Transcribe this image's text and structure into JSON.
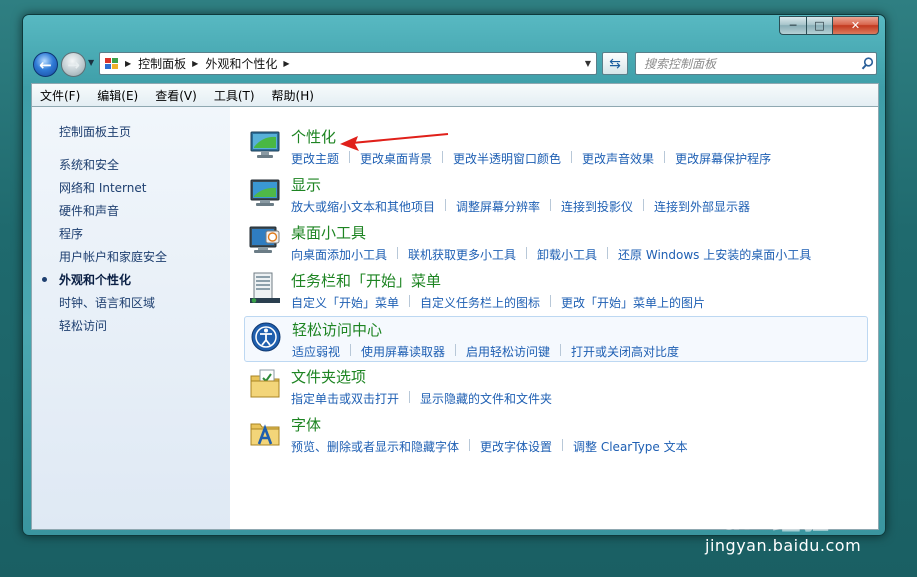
{
  "window": {
    "caption_min": "─",
    "caption_max": "□",
    "caption_close": "✕"
  },
  "address_bar": {
    "crumbs": [
      "控制面板",
      "外观和个性化"
    ],
    "search_placeholder": "搜索控制面板"
  },
  "menu": [
    "文件(F)",
    "编辑(E)",
    "查看(V)",
    "工具(T)",
    "帮助(H)"
  ],
  "sidebar": {
    "home": "控制面板主页",
    "items": [
      "系统和安全",
      "网络和 Internet",
      "硬件和声音",
      "程序",
      "用户帐户和家庭安全",
      "外观和个性化",
      "时钟、语言和区域",
      "轻松访问"
    ],
    "active_index": 5
  },
  "categories": [
    {
      "title": "个性化",
      "icon": "personalization-icon",
      "links": [
        "更改主题",
        "更改桌面背景",
        "更改半透明窗口颜色",
        "更改声音效果",
        "更改屏幕保护程序"
      ]
    },
    {
      "title": "显示",
      "icon": "display-icon",
      "links": [
        "放大或缩小文本和其他项目",
        "调整屏幕分辨率",
        "连接到投影仪",
        "连接到外部显示器"
      ]
    },
    {
      "title": "桌面小工具",
      "icon": "gadgets-icon",
      "links": [
        "向桌面添加小工具",
        "联机获取更多小工具",
        "卸载小工具",
        "还原 Windows 上安装的桌面小工具"
      ]
    },
    {
      "title": "任务栏和「开始」菜单",
      "icon": "taskbar-icon",
      "links": [
        "自定义「开始」菜单",
        "自定义任务栏上的图标",
        "更改「开始」菜单上的图片"
      ]
    },
    {
      "title": "轻松访问中心",
      "icon": "ease-of-access-icon",
      "links": [
        "适应弱视",
        "使用屏幕读取器",
        "启用轻松访问键",
        "打开或关闭高对比度"
      ]
    },
    {
      "title": "文件夹选项",
      "icon": "folder-options-icon",
      "links": [
        "指定单击或双击打开",
        "显示隐藏的文件和文件夹"
      ]
    },
    {
      "title": "字体",
      "icon": "fonts-icon",
      "links": [
        "预览、删除或者显示和隐藏字体",
        "更改字体设置",
        "调整 ClearType 文本"
      ]
    }
  ],
  "highlighted_category_index": 4,
  "watermark": {
    "brand": "Bai",
    "brand_paw": "❀",
    "brand_tail": "经验",
    "url": "jingyan.baidu.com"
  },
  "colors": {
    "link": "#1e5fb3",
    "category_title": "#1d8422",
    "annotation_arrow": "#e0201a"
  }
}
